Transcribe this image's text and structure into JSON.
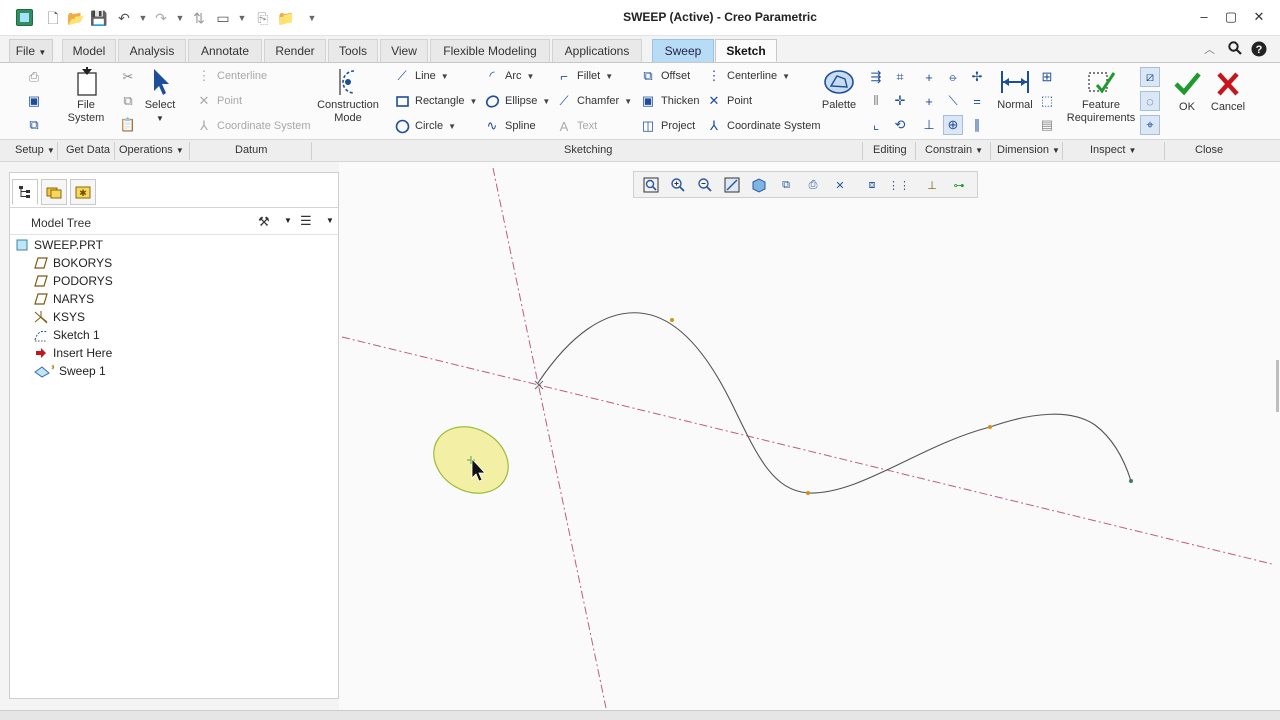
{
  "window": {
    "title": "SWEEP (Active) - Creo Parametric"
  },
  "tabs": {
    "file": "File",
    "items": [
      "Model",
      "Analysis",
      "Annotate",
      "Render",
      "Tools",
      "View",
      "Flexible Modeling",
      "Applications"
    ],
    "sweep": "Sweep",
    "sketch": "Sketch"
  },
  "ribbon": {
    "get_data": {
      "file_system": "File\nSystem"
    },
    "operations": {
      "select": "Select"
    },
    "datum": {
      "centerline": "Centerline",
      "point": "Point",
      "coordinate_system": "Coordinate System"
    },
    "construction_mode": "Construction\nMode",
    "sketching": {
      "line": "Line",
      "rectangle": "Rectangle",
      "circle": "Circle",
      "arc": "Arc",
      "ellipse": "Ellipse",
      "spline": "Spline",
      "fillet": "Fillet",
      "chamfer": "Chamfer",
      "text": "Text",
      "offset": "Offset",
      "thicken": "Thicken",
      "project": "Project",
      "centerline": "Centerline",
      "point": "Point",
      "coordinate_system": "Coordinate System",
      "palette": "Palette"
    },
    "dimension": {
      "normal": "Normal"
    },
    "inspect": {
      "feature_requirements": "Feature\nRequirements"
    },
    "close": {
      "ok": "OK",
      "cancel": "Cancel"
    }
  },
  "groups": {
    "setup": "Setup",
    "get_data": "Get Data",
    "operations": "Operations",
    "datum": "Datum",
    "sketching": "Sketching",
    "editing": "Editing",
    "constrain": "Constrain",
    "dimension": "Dimension",
    "inspect": "Inspect",
    "close": "Close"
  },
  "model_tree": {
    "title": "Model Tree",
    "items": [
      {
        "label": "SWEEP.PRT",
        "icon": "part-icon"
      },
      {
        "label": "BOKORYS",
        "icon": "datum-plane-icon"
      },
      {
        "label": "PODORYS",
        "icon": "datum-plane-icon"
      },
      {
        "label": "NARYS",
        "icon": "datum-plane-icon"
      },
      {
        "label": "KSYS",
        "icon": "coordinate-system-icon"
      },
      {
        "label": "Sketch 1",
        "icon": "sketch-icon"
      },
      {
        "label": "Insert Here",
        "icon": "insert-arrow-icon"
      },
      {
        "label": "Sweep 1",
        "icon": "sweep-feature-icon"
      }
    ]
  },
  "colors": {
    "accent_tab": "#b9dcf6",
    "ok_green": "#1e9a2f",
    "cancel_red": "#c4161c",
    "centerline": "#c05a8a",
    "ellipse_fill": "#f3f0a6"
  }
}
